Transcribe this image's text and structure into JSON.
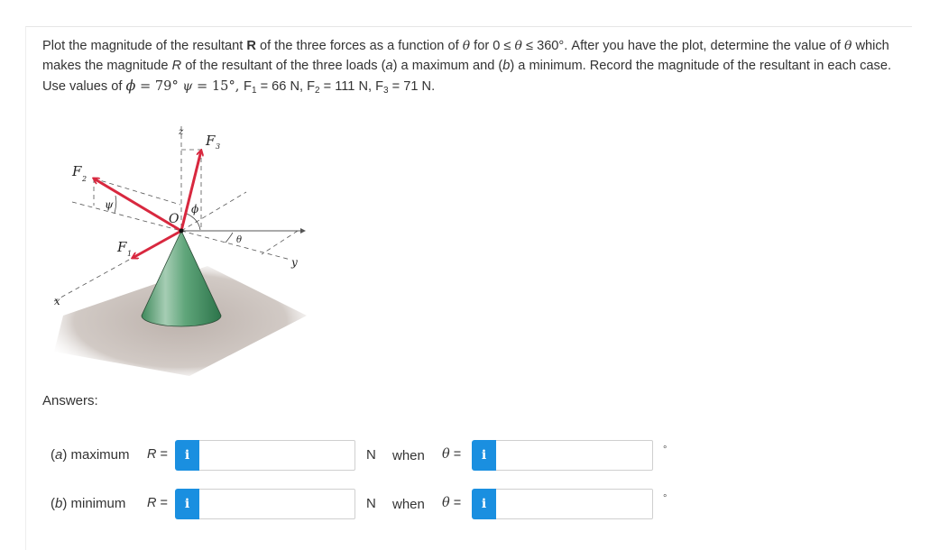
{
  "problem": {
    "part1": "Plot the magnitude of the resultant ",
    "bold_R": "R",
    "part2": " of the three forces as a function of ",
    "theta": "θ",
    "part3": " for 0 ≤ ",
    "part4": " ≤ 360°. After you have the plot, determine the value of ",
    "part5": " which makes the magnitude ",
    "italic_R": "R",
    "part6": " of the resultant of the three loads (",
    "a": "a",
    "part7": ") a maximum and (",
    "b": "b",
    "part8": ") a minimum. Record the magnitude of the resultant in each case. Use values of ",
    "phi": "ϕ",
    "phi_value": " = 79° ",
    "psi": "ψ",
    "psi_value": " = 15°, ",
    "F1_label": "F",
    "F1_sub": "1",
    "F1_value": " = 66 N, ",
    "F2_label": "F",
    "F2_sub": "2",
    "F2_value": " = 111 N, ",
    "F3_label": "F",
    "F3_sub": "3",
    "F3_value": " = 71 N."
  },
  "given": {
    "phi_deg": 79,
    "psi_deg": 15,
    "F1_N": 66,
    "F2_N": 111,
    "F3_N": 71,
    "theta_range": "0 ≤ θ ≤ 360°"
  },
  "figure": {
    "labels": {
      "z": "z",
      "x": "x",
      "y": "y",
      "O": "O",
      "F1": "F",
      "F1_sub": "1",
      "F2": "F",
      "F2_sub": "2",
      "F3": "F",
      "F3_sub": "3",
      "psi": "ψ",
      "phi": "ϕ",
      "theta": "θ"
    },
    "colors": {
      "force_arrow": "#d8283f",
      "cone": "#4f9a6c",
      "cone_dark": "#2f7a4c",
      "shadow": "#c9c1bc",
      "axis": "#555555"
    }
  },
  "answers": {
    "heading": "Answers:",
    "rows": [
      {
        "label_open": "(",
        "label_letter": "a",
        "label_rest": ") maximum",
        "R_label": "R",
        "equals": " =",
        "info_icon": "i",
        "R_value": "",
        "unit": "N",
        "when": "when",
        "theta_label": "θ",
        "theta_equals": " =",
        "theta_value": "",
        "degree_symbol": "°"
      },
      {
        "label_open": "(",
        "label_letter": "b",
        "label_rest": ") minimum",
        "R_label": "R",
        "equals": " =",
        "info_icon": "i",
        "R_value": "",
        "unit": "N",
        "when": "when",
        "theta_label": "θ",
        "theta_equals": " =",
        "theta_value": "",
        "degree_symbol": "°"
      }
    ]
  },
  "theme": {
    "info_button_color": "#1a8fe0",
    "input_border": "#cfcfcf",
    "text_color": "#333333"
  }
}
